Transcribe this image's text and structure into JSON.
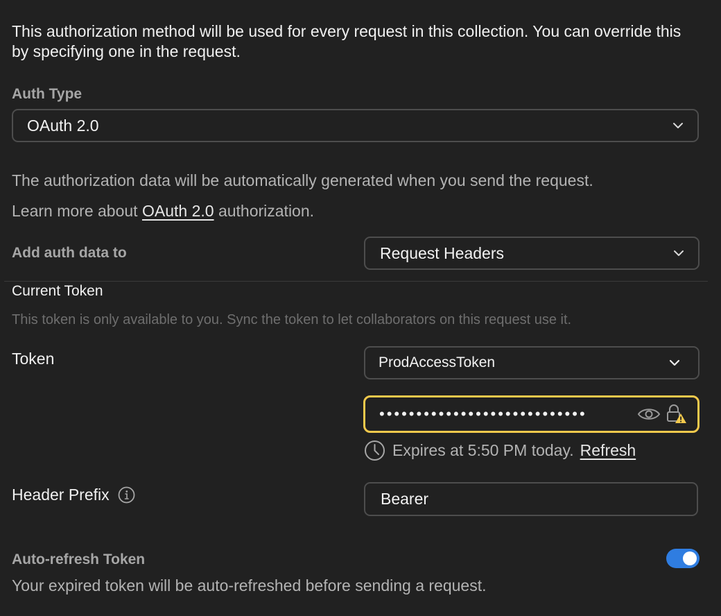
{
  "intro": {
    "text": "This authorization method will be used for every request in this collection. You can override this by specifying one in the request."
  },
  "auth_type": {
    "label": "Auth Type",
    "value": "OAuth 2.0"
  },
  "info": {
    "line1": "The authorization data will be automatically generated when you send the request.",
    "learn_prefix": "Learn more about",
    "learn_link": "OAuth 2.0",
    "learn_suffix": "authorization."
  },
  "add_auth": {
    "label": "Add auth data to",
    "value": "Request Headers"
  },
  "current_token": {
    "title": "Current Token",
    "hint": "This token is only available to you. Sync the token to let collaborators on this request use it."
  },
  "token": {
    "label": "Token",
    "selected": "ProdAccessToken",
    "masked_value": "••••••••••••••••••••••••••••",
    "expires_text": "Expires at 5:50 PM today.",
    "refresh_label": "Refresh",
    "warning_color": "#f2c94c"
  },
  "header_prefix": {
    "label": "Header Prefix",
    "value": "Bearer"
  },
  "auto_refresh": {
    "label": "Auto-refresh Token",
    "description": "Your expired token will be auto-refreshed before sending a request.",
    "enabled": true,
    "toggle_color": "#2f7de1"
  },
  "icons": {
    "chevron": "chevron-down-icon",
    "eye": "eye-icon",
    "lock_warning": "lock-warning-icon",
    "clock": "clock-icon",
    "info": "info-icon"
  }
}
